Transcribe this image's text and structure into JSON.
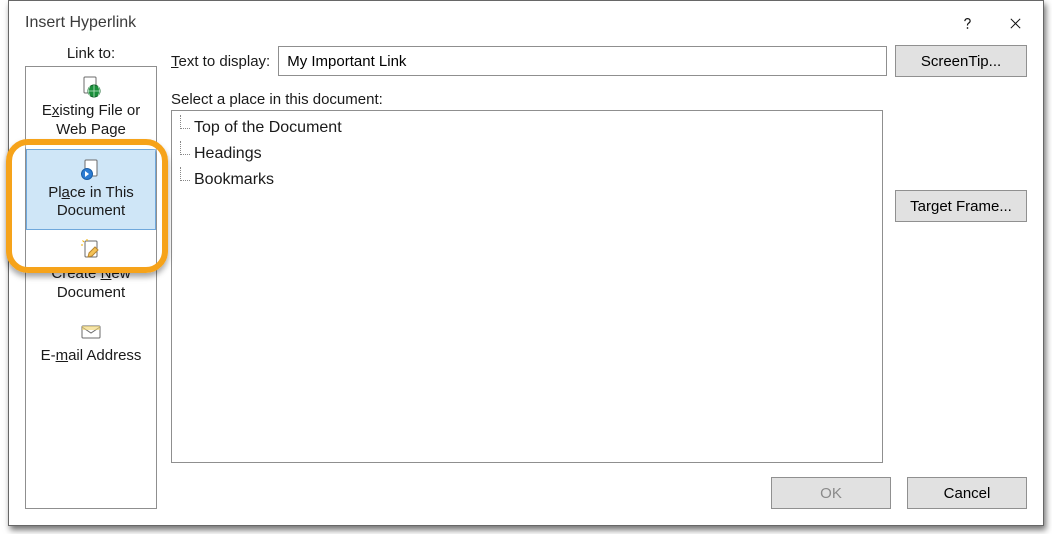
{
  "dialog": {
    "title": "Insert Hyperlink"
  },
  "left": {
    "heading": "Link to:"
  },
  "linkbar": {
    "items": [
      {
        "id": "existing",
        "label_pre": "E",
        "label_u": "x",
        "label_post": "isting File or Web Page",
        "selected": false
      },
      {
        "id": "place-in-doc",
        "label_pre": "Pl",
        "label_u": "a",
        "label_post": "ce in This Document",
        "selected": true
      },
      {
        "id": "create-new",
        "label_pre": "Create ",
        "label_u": "N",
        "label_post": "ew Document",
        "selected": false
      },
      {
        "id": "email",
        "label_pre": "E-",
        "label_u": "m",
        "label_post": "ail Address",
        "selected": false
      }
    ]
  },
  "text_to_display": {
    "label_pre": "",
    "label_u": "T",
    "label_post": "ext to display:",
    "value": "My Important Link"
  },
  "screentip_label": "ScreenTip...",
  "select_label": "Select a place in this document:",
  "tree": {
    "nodes": [
      "Top of the Document",
      "Headings",
      "Bookmarks"
    ]
  },
  "target_frame_label": "Target Frame...",
  "ok_label": "OK",
  "cancel_label": "Cancel"
}
